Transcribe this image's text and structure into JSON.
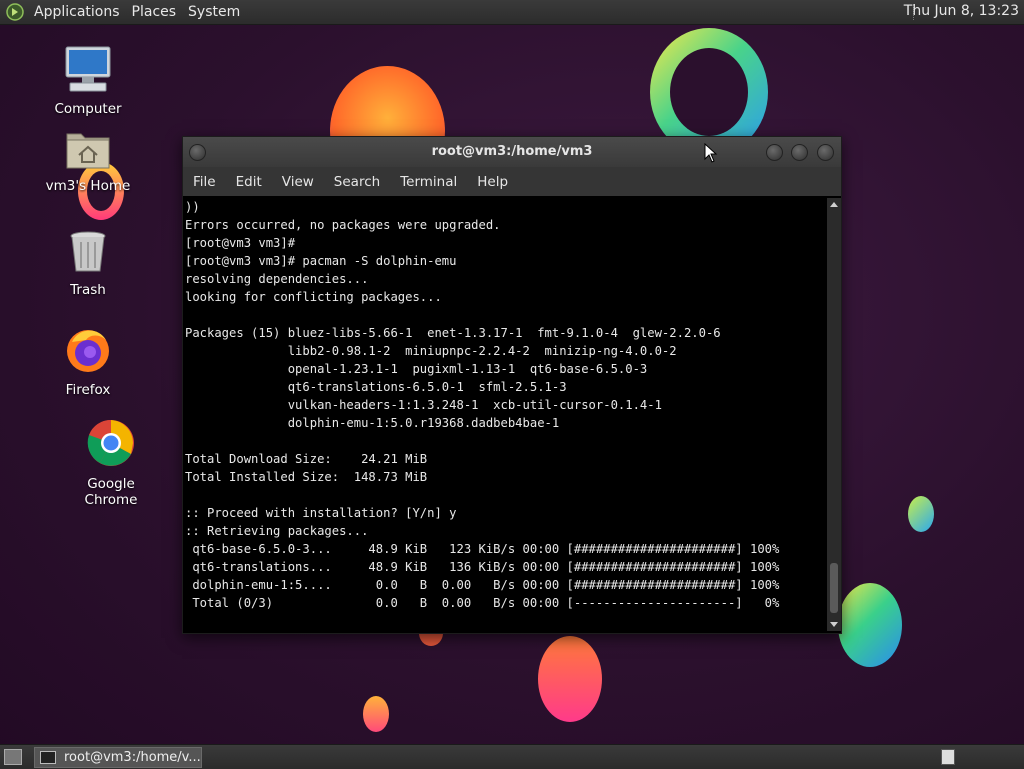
{
  "top_panel": {
    "menus": [
      "Applications",
      "Places",
      "System"
    ],
    "clock": "Thu Jun  8, 13:23"
  },
  "desktop_icons": [
    {
      "label": "Computer",
      "icon": "computer-icon"
    },
    {
      "label": "vm3's Home",
      "icon": "home-folder-icon"
    },
    {
      "label": "Trash",
      "icon": "trash-icon"
    },
    {
      "label": "Firefox",
      "icon": "firefox-icon"
    },
    {
      "label": "Google Chrome",
      "icon": "chrome-icon"
    }
  ],
  "terminal": {
    "title": "root@vm3:/home/vm3",
    "menu": [
      "File",
      "Edit",
      "View",
      "Search",
      "Terminal",
      "Help"
    ],
    "lines": [
      "))",
      "Errors occurred, no packages were upgraded.",
      "[root@vm3 vm3]#",
      "[root@vm3 vm3]# pacman -S dolphin-emu",
      "resolving dependencies...",
      "looking for conflicting packages...",
      "",
      "Packages (15) bluez-libs-5.66-1  enet-1.3.17-1  fmt-9.1.0-4  glew-2.2.0-6",
      "              libb2-0.98.1-2  miniupnpc-2.2.4-2  minizip-ng-4.0.0-2",
      "              openal-1.23.1-1  pugixml-1.13-1  qt6-base-6.5.0-3",
      "              qt6-translations-6.5.0-1  sfml-2.5.1-3",
      "              vulkan-headers-1:1.3.248-1  xcb-util-cursor-0.1.4-1",
      "              dolphin-emu-1:5.0.r19368.dadbeb4bae-1",
      "",
      "Total Download Size:    24.21 MiB",
      "Total Installed Size:  148.73 MiB",
      "",
      ":: Proceed with installation? [Y/n] y",
      ":: Retrieving packages...",
      " qt6-base-6.5.0-3...     48.9 KiB   123 KiB/s 00:00 [######################] 100%",
      " qt6-translations...     48.9 KiB   136 KiB/s 00:00 [######################] 100%",
      " dolphin-emu-1:5....      0.0   B  0.00   B/s 00:00 [######################] 100%",
      " Total (0/3)              0.0   B  0.00   B/s 00:00 [----------------------]   0%"
    ]
  },
  "taskbar": {
    "task_label": "root@vm3:/home/v..."
  },
  "colors": {
    "panel": "#333333",
    "terminal_bg": "#000000",
    "terminal_fg": "#e8e8e8",
    "wallpaper": "#2b102d"
  }
}
